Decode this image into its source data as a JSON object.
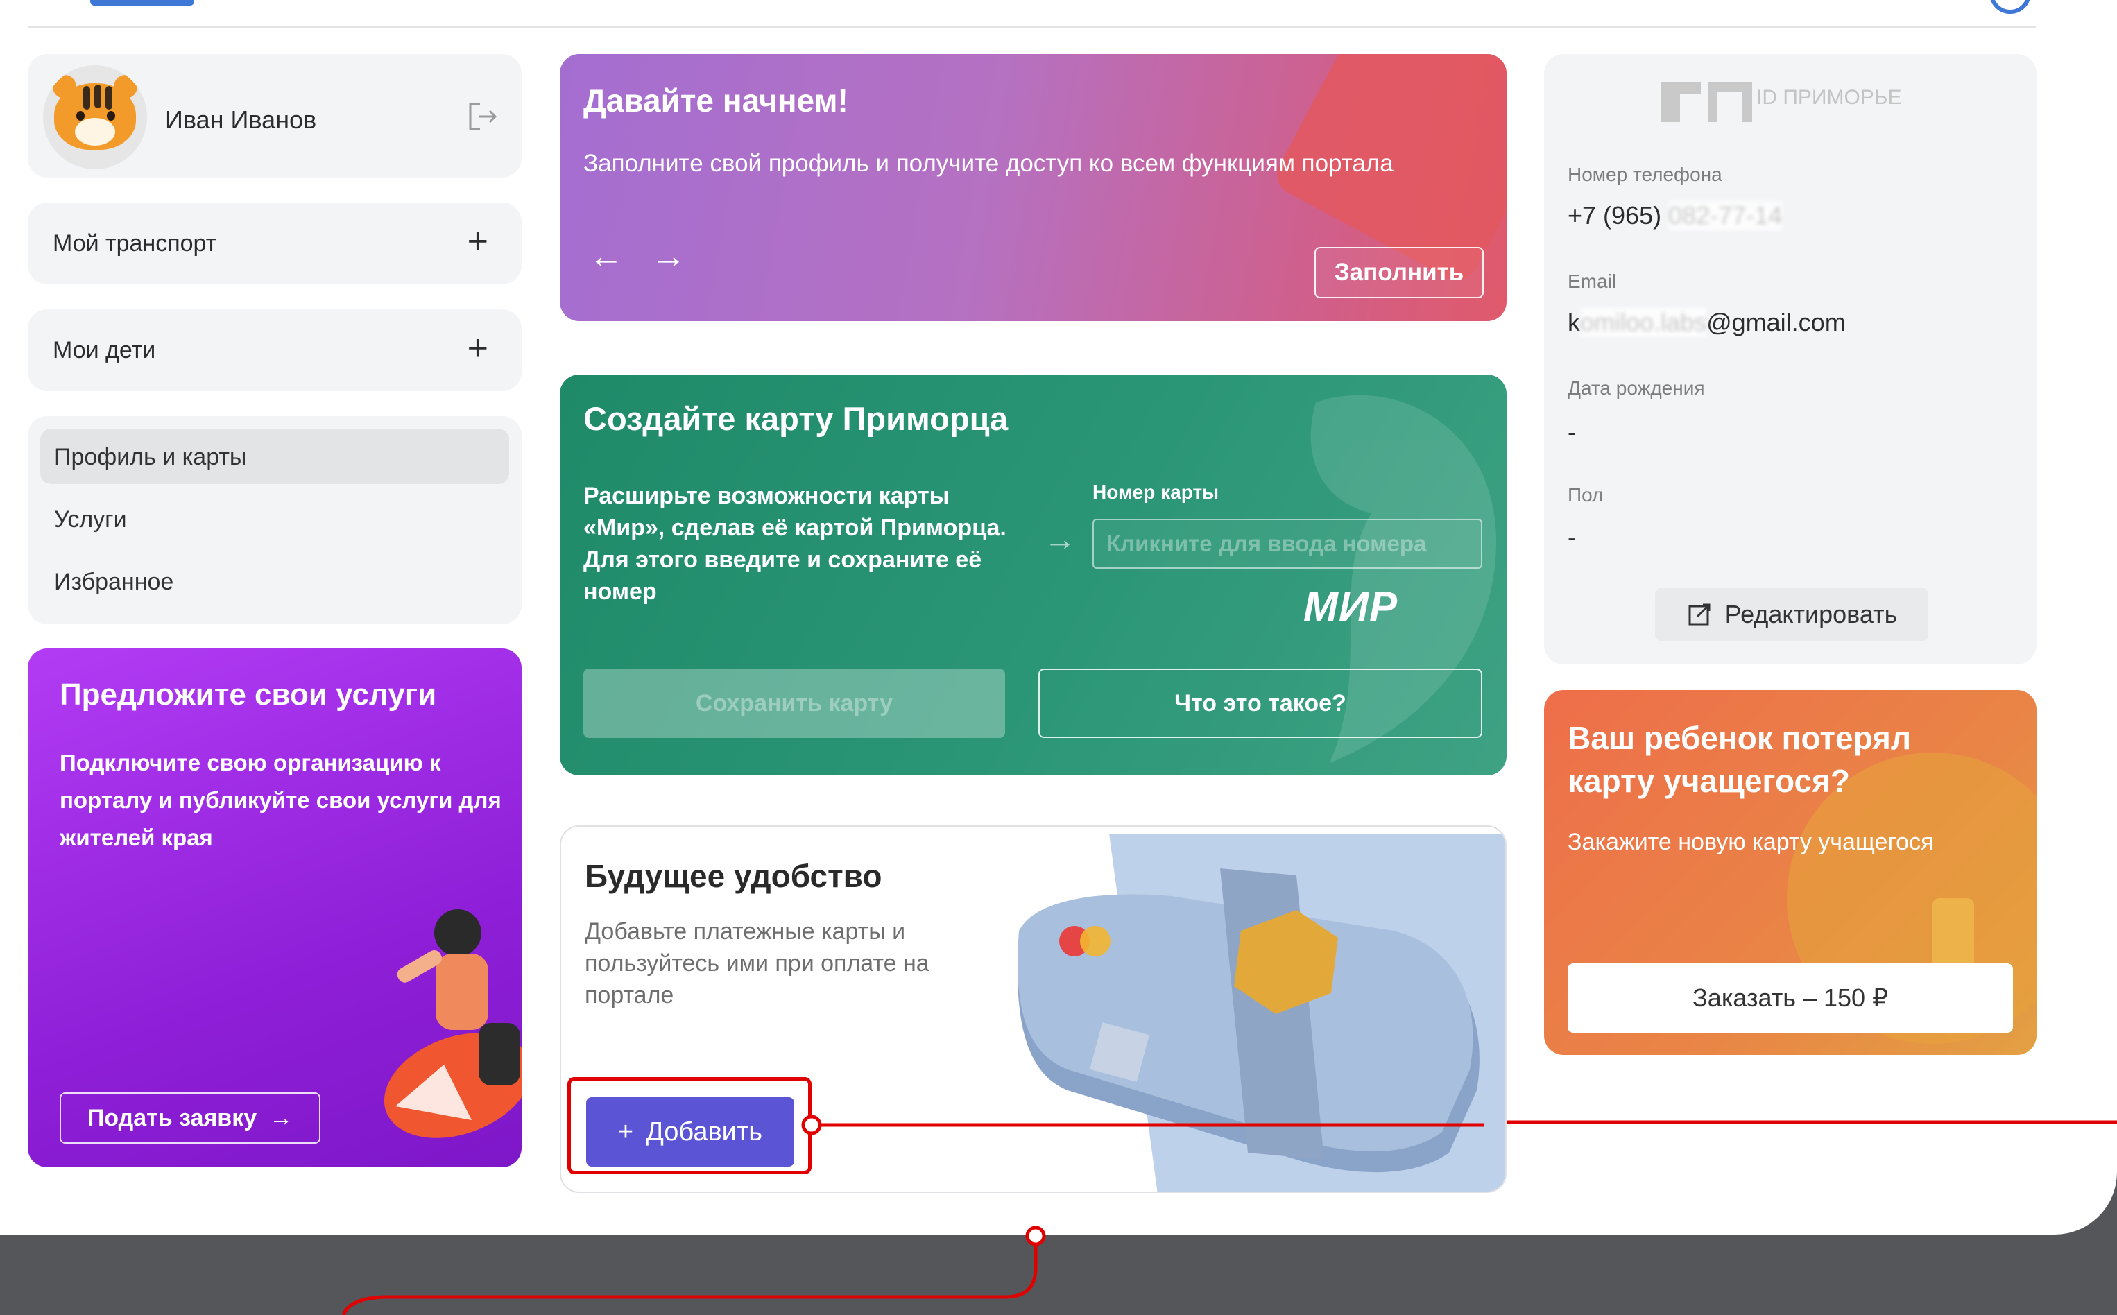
{
  "user": {
    "name": "Иван Иванов"
  },
  "sidebar": {
    "transport_label": "Мой транспорт",
    "children_label": "Мои дети",
    "nav": [
      {
        "label": "Профиль и карты"
      },
      {
        "label": "Услуги"
      },
      {
        "label": "Избранное"
      }
    ],
    "offer": {
      "title": "Предложите свои услуги",
      "text": "Подключите свою организацию к порталу и публикуйте свои услуги для жителей края",
      "button": "Подать заявку"
    }
  },
  "start_banner": {
    "title": "Давайте начнем!",
    "text": "Заполните свой профиль и получите доступ ко всем функциям портала",
    "button": "Заполнить"
  },
  "mir_card": {
    "title": "Создайте карту Приморца",
    "text": "Расширьте возможности карты «Мир», сделав её картой Приморца. Для этого введите и сохраните её номер",
    "input_label": "Номер карты",
    "input_placeholder": "Кликните для ввода номера",
    "logo": "МИР",
    "save_button": "Сохранить карту",
    "info_button": "Что это такое?"
  },
  "future": {
    "title": "Будущее удобство",
    "text": "Добавьте платежные карты и пользуйтесь ими при оплате на портале",
    "add_button": "Добавить"
  },
  "profile": {
    "logo_text": "ID ПРИМОРЬЕ",
    "phone_label": "Номер телефона",
    "phone_visible": "+7 (965)",
    "phone_hidden": "082-77-14",
    "email_label": "Email",
    "email_prefix": "k",
    "email_hidden": "omiloo.labs",
    "email_suffix": "@gmail.com",
    "birth_label": "Дата рождения",
    "birth_value": "-",
    "gender_label": "Пол",
    "gender_value": "-",
    "edit_button": "Редактировать"
  },
  "child_card": {
    "title": "Ваш ребенок потерял карту учащегося?",
    "text": "Закажите новую карту учащегося",
    "button": "Заказать – 150 ₽"
  },
  "colors": {
    "accent": "#5b55d6",
    "highlight": "#e00000",
    "mir_green": "#2b9676",
    "offer_purple": "#9b27e0",
    "child_orange": "#ec7a48"
  }
}
